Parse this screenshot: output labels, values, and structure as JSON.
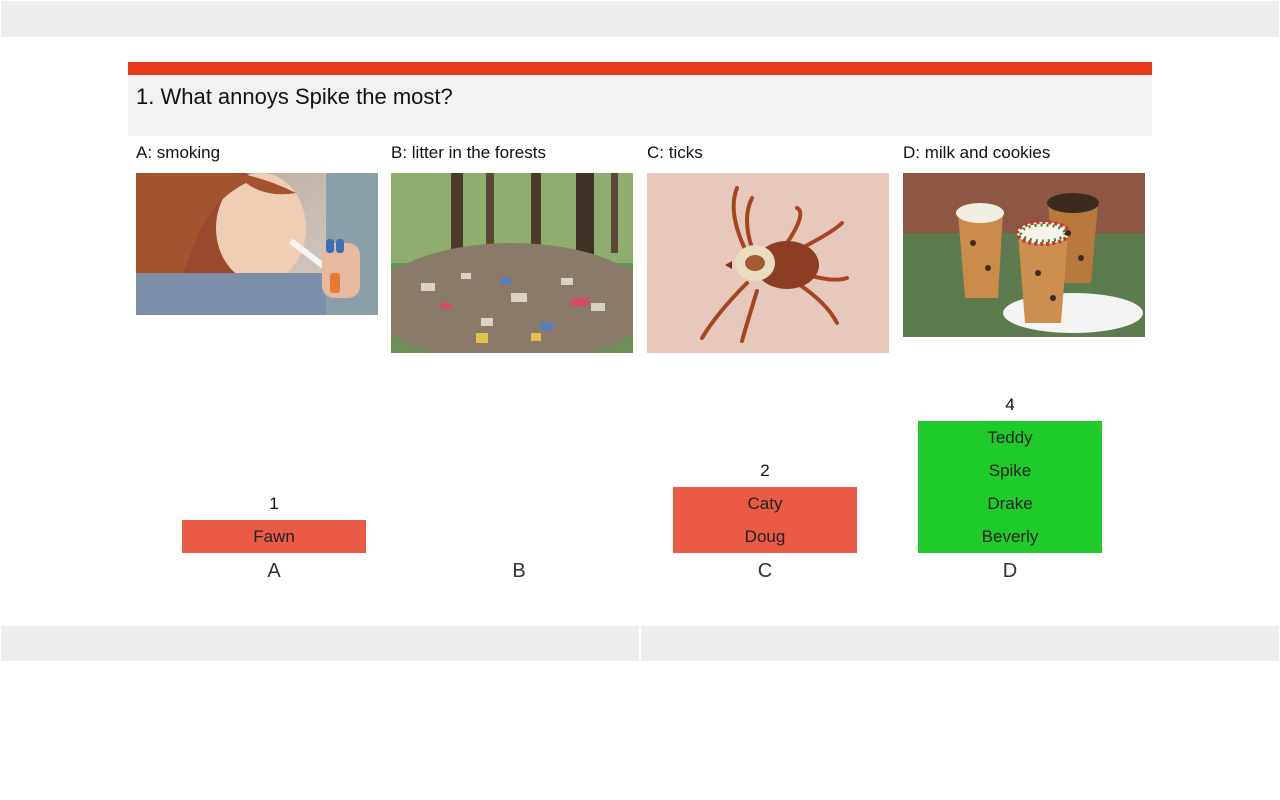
{
  "question": {
    "title": "1. What annoys Spike the most?",
    "accent_color": "#e8381c"
  },
  "options": [
    {
      "key": "A",
      "label": "A: smoking",
      "image": "woman-smoking-photo"
    },
    {
      "key": "B",
      "label": "B: litter in the forests",
      "image": "forest-litter-photo"
    },
    {
      "key": "C",
      "label": "C: ticks",
      "image": "tick-on-skin-photo"
    },
    {
      "key": "D",
      "label": "D: milk and cookies",
      "image": "cookie-shot-glasses-photo"
    }
  ],
  "chart_data": {
    "type": "bar",
    "categories": [
      "A",
      "B",
      "C",
      "D"
    ],
    "values": [
      1,
      0,
      2,
      4
    ],
    "voters": [
      [
        "Fawn"
      ],
      [],
      [
        "Caty",
        "Doug"
      ],
      [
        "Teddy",
        "Spike",
        "Drake",
        "Beverly"
      ]
    ],
    "correct_category": "D",
    "colors": {
      "wrong": "#ea5b45",
      "correct": "#1fcb2a"
    }
  }
}
